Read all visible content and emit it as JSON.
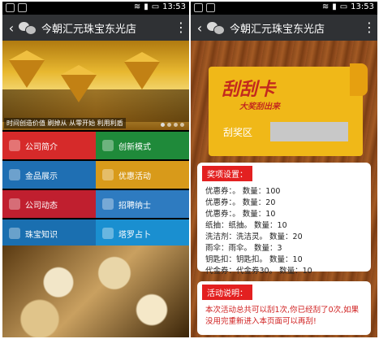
{
  "status": {
    "time": "13:53"
  },
  "app": {
    "title": "今朝汇元珠宝东光店",
    "back": "‹",
    "menu": "⋮"
  },
  "banner": {
    "caption": "时间创造价值 刷掉从 从零开始 利用利盾",
    "page_count": 4,
    "active_index": 0
  },
  "menu_rows": [
    {
      "left": {
        "label": "公司简介",
        "color": "#d62a2a"
      },
      "right": {
        "label": "创新模式",
        "color": "#1f8a3a"
      }
    },
    {
      "left": {
        "label": "金品展示",
        "color": "#1f6fb3"
      },
      "right": {
        "label": "优惠活动",
        "color": "#d89a1a"
      }
    },
    {
      "left": {
        "label": "公司动态",
        "color": "#c01f2f"
      },
      "right": {
        "label": "招聘纳士",
        "color": "#2e7bc0"
      }
    },
    {
      "left": {
        "label": "珠宝知识",
        "color": "#1a6fb0"
      },
      "right": {
        "label": "塔罗占卜",
        "color": "#1a8fd0"
      }
    }
  ],
  "card": {
    "title": "刮刮卡",
    "subtitle": "大奖刮出来",
    "zone_label": "刮奖区"
  },
  "prizes": {
    "header": "奖项设置：",
    "items": [
      "优惠券：。 数量：100",
      "优惠券：。 数量：20",
      "优惠券：。 数量：10",
      "纸抽：纸抽。 数量：10",
      "洗洁剂：洗洁灵。 数量：20",
      "雨伞：雨伞。 数量：3",
      "钥匙扣：钥匙扣。 数量：10",
      "代金券：代金券30。 数量：10"
    ]
  },
  "activity": {
    "header": "活动说明：",
    "text": "本次活动总共可以刮1次,你已经刮了0次,如果没用完重新进入本页面可以再刮!"
  }
}
